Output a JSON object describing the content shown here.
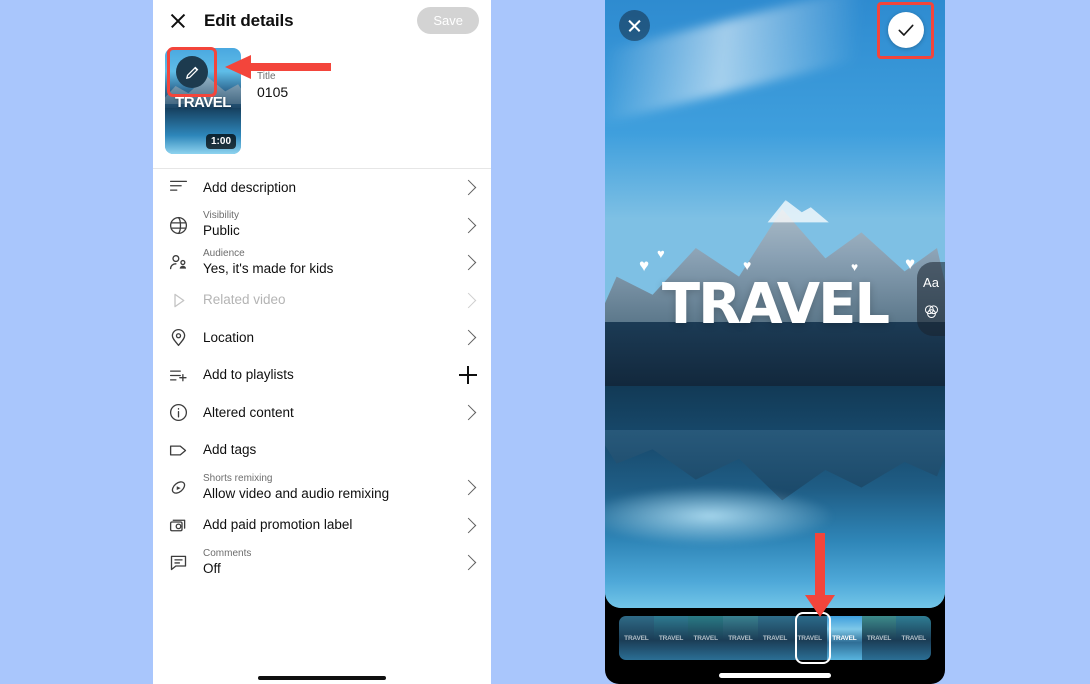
{
  "background_color": "#a9c6fc",
  "edit_panel": {
    "close_icon": "close-icon",
    "title": "Edit details",
    "save_label": "Save",
    "video": {
      "title_label": "Title",
      "title_value": "0105",
      "duration": "1:00",
      "thumbnail_text": "TRAVEL",
      "edit_icon": "pencil-icon"
    },
    "options": [
      {
        "icon": "description-icon",
        "label": "Add description",
        "sub": "",
        "accessory": "chevron",
        "disabled": false
      },
      {
        "icon": "globe-icon",
        "label": "Public",
        "sub": "Visibility",
        "accessory": "chevron",
        "disabled": false
      },
      {
        "icon": "audience-icon",
        "label": "Yes, it's made for kids",
        "sub": "Audience",
        "accessory": "chevron",
        "disabled": false
      },
      {
        "icon": "play-triangle-icon",
        "label": "Related video",
        "sub": "",
        "accessory": "chevron",
        "disabled": true
      },
      {
        "icon": "location-pin-icon",
        "label": "Location",
        "sub": "",
        "accessory": "chevron",
        "disabled": false
      },
      {
        "icon": "playlist-add-icon",
        "label": "Add to playlists",
        "sub": "",
        "accessory": "plus",
        "disabled": false
      },
      {
        "icon": "info-circle-icon",
        "label": "Altered content",
        "sub": "",
        "accessory": "chevron",
        "disabled": false
      },
      {
        "icon": "tag-icon",
        "label": "Add tags",
        "sub": "",
        "accessory": "none",
        "disabled": false
      },
      {
        "icon": "remix-icon",
        "label": "Allow video and audio remixing",
        "sub": "Shorts remixing",
        "accessory": "chevron",
        "disabled": false
      },
      {
        "icon": "paid-promotion-icon",
        "label": "Add paid promotion label",
        "sub": "",
        "accessory": "chevron",
        "disabled": false
      },
      {
        "icon": "comments-icon",
        "label": "Off",
        "sub": "Comments",
        "accessory": "chevron",
        "disabled": false
      }
    ]
  },
  "video_editor": {
    "close_icon": "close-icon",
    "done_icon": "check-icon",
    "overlay_text": "TRAVEL",
    "tools": [
      {
        "icon": "text-tool-icon",
        "label": "Aa"
      },
      {
        "icon": "filters-icon",
        "label": ""
      }
    ],
    "timeline": {
      "frame_label": "TRAVEL",
      "frame_count": 9,
      "selected_index": 6
    }
  },
  "annotations": {
    "highlight_color": "#f3453b",
    "arrow_edit_target": "pencil-icon",
    "arrow_timeline_target": "selected-frame"
  }
}
